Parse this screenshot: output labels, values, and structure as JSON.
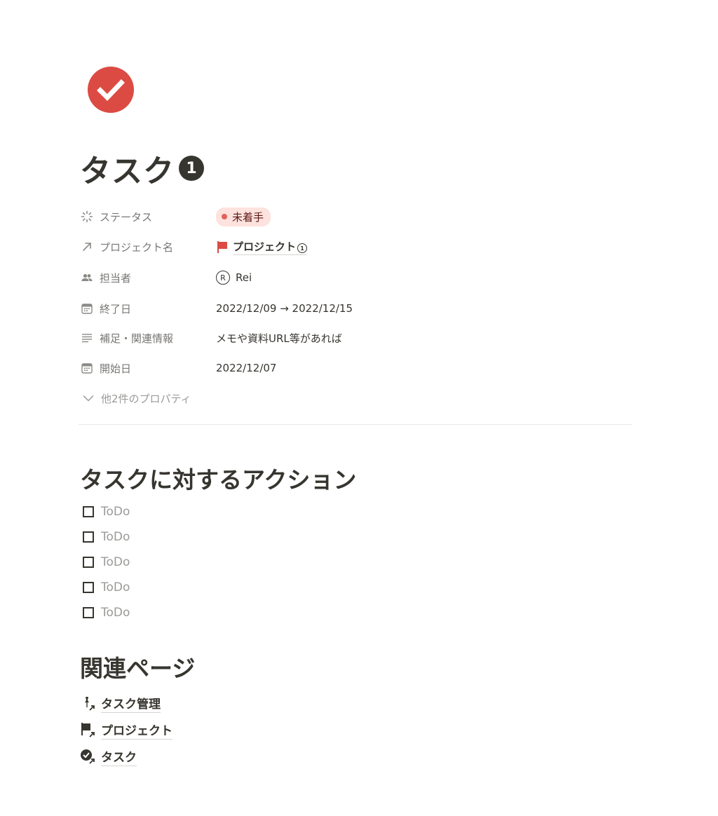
{
  "page": {
    "icon": "check-circle-icon",
    "title": "タスク",
    "title_badge": "1"
  },
  "colors": {
    "accent_red": "#e16259",
    "status_bg": "#fde2dd",
    "text": "#37352f",
    "muted": "#787774"
  },
  "properties": [
    {
      "icon": "status-icon",
      "name": "ステータス",
      "value": "未着手"
    },
    {
      "icon": "relation-arrow-icon",
      "name": "プロジェクト名",
      "value": "プロジェクト",
      "value_badge": "1"
    },
    {
      "icon": "people-icon",
      "name": "担当者",
      "avatar": "R",
      "value": "Rei"
    },
    {
      "icon": "calendar-icon",
      "name": "終了日",
      "value": "2022/12/09 → 2022/12/15"
    },
    {
      "icon": "text-lines-icon",
      "name": "補足・関連情報",
      "value": "メモや資料URL等があれば"
    },
    {
      "icon": "calendar-icon",
      "name": "開始日",
      "value": "2022/12/07"
    }
  ],
  "more_properties": "他2件のプロパティ",
  "actions_section": {
    "heading": "タスクに対するアクション",
    "todos": [
      "ToDo",
      "ToDo",
      "ToDo",
      "ToDo",
      "ToDo"
    ]
  },
  "related_section": {
    "heading": "関連ページ",
    "links": [
      {
        "icon": "pin-link-icon",
        "label": "タスク管理"
      },
      {
        "icon": "flag-link-icon",
        "label": "プロジェクト"
      },
      {
        "icon": "check-link-icon",
        "label": "タスク"
      }
    ]
  }
}
